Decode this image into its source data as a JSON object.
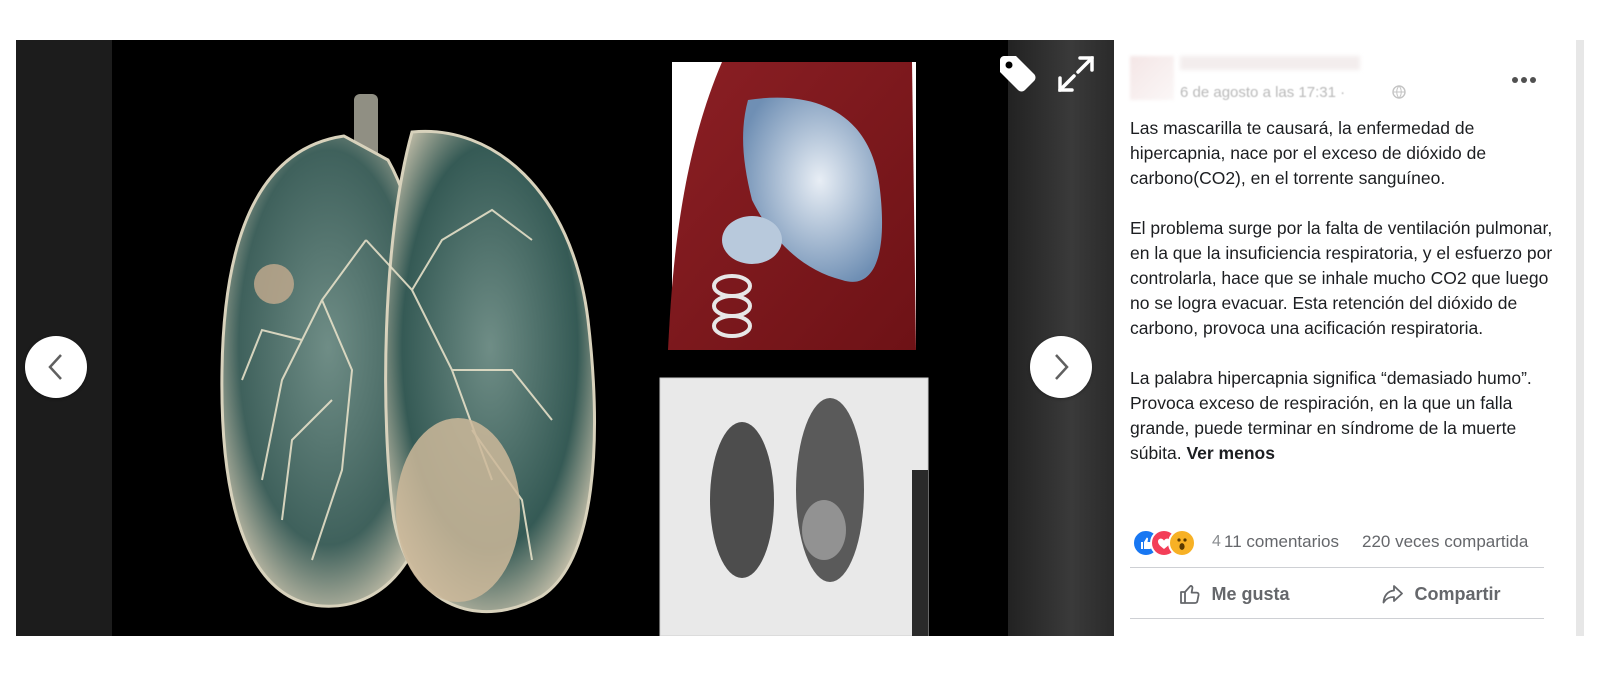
{
  "viewer": {
    "prev_icon": "chevron-left-icon",
    "next_icon": "chevron-right-icon",
    "tag_icon": "tag-icon",
    "expand_icon": "expand-icon"
  },
  "post": {
    "timestamp": "6 de agosto a las 17:31 ·",
    "paragraphs": [
      "Las mascarilla te causará, la enfermedad de hipercapnia, nace por el exceso de dióxido de carbono(CO2), en el torrente sanguíneo.",
      "El problema surge por la falta de ventilación pulmonar, en la que la insuficiencia respiratoria, y el esfuerzo por controlarla, hace que se inhale mucho CO2 que luego no se logra evacuar. Esta retención del dióxido de carbono, provoca una acificación respiratoria.",
      "La palabra hipercapnia significa “demasiado humo”. Provoca exceso de respiración, en la que un falla grande, puede terminar en síndrome de la muerte súbita."
    ],
    "see_less": "Ver menos"
  },
  "stats": {
    "reactions": [
      "like",
      "love",
      "wow"
    ],
    "reaction_count": "4",
    "comments": "11 comentarios",
    "shares": "220 veces compartida"
  },
  "actions": {
    "like": "Me gusta",
    "share": "Compartir"
  },
  "colors": {
    "like_blue": "#1877f2",
    "love_red": "#f33e58",
    "wow_yellow": "#f7b125",
    "secondary_text": "#65676b"
  }
}
